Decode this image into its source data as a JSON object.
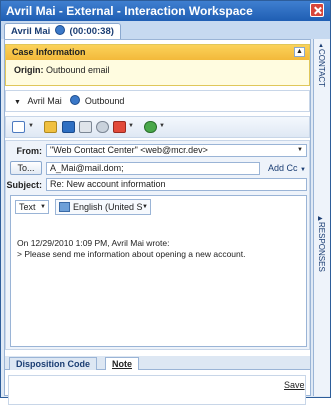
{
  "window": {
    "title": "Avril Mai - External - Interaction Workspace"
  },
  "tab": {
    "name": "Avril Mai",
    "timer": "(00:00:38)"
  },
  "case": {
    "header": "Case Information",
    "origin_label": "Origin:",
    "origin_value": "Outbound email"
  },
  "party": {
    "name": "Avril Mai",
    "direction": "Outbound"
  },
  "side_tabs": {
    "contact": "CONTACT",
    "responses": "RESPONSES"
  },
  "compose": {
    "from_label": "From:",
    "from_value": "\"Web Contact Center\" <web@mcr.dev>",
    "to_button": "To...",
    "to_value": "A_Mai@mail.dom;",
    "add_cc": "Add Cc",
    "subject_label": "Subject:",
    "subject_value": "Re: New account information",
    "format": "Text",
    "language": "English (United S",
    "body_line1": "On 12/29/2010 1:09 PM, Avril Mai wrote:",
    "body_line2": "> Please send me information about opening a new account."
  },
  "bottom": {
    "tab_disposition": "Disposition Code",
    "tab_note": "Note",
    "save": "Save"
  },
  "colors": {
    "title_bar": "#1f5eb3",
    "case_header": "#f3b93a",
    "panel": "#eef3fa"
  }
}
